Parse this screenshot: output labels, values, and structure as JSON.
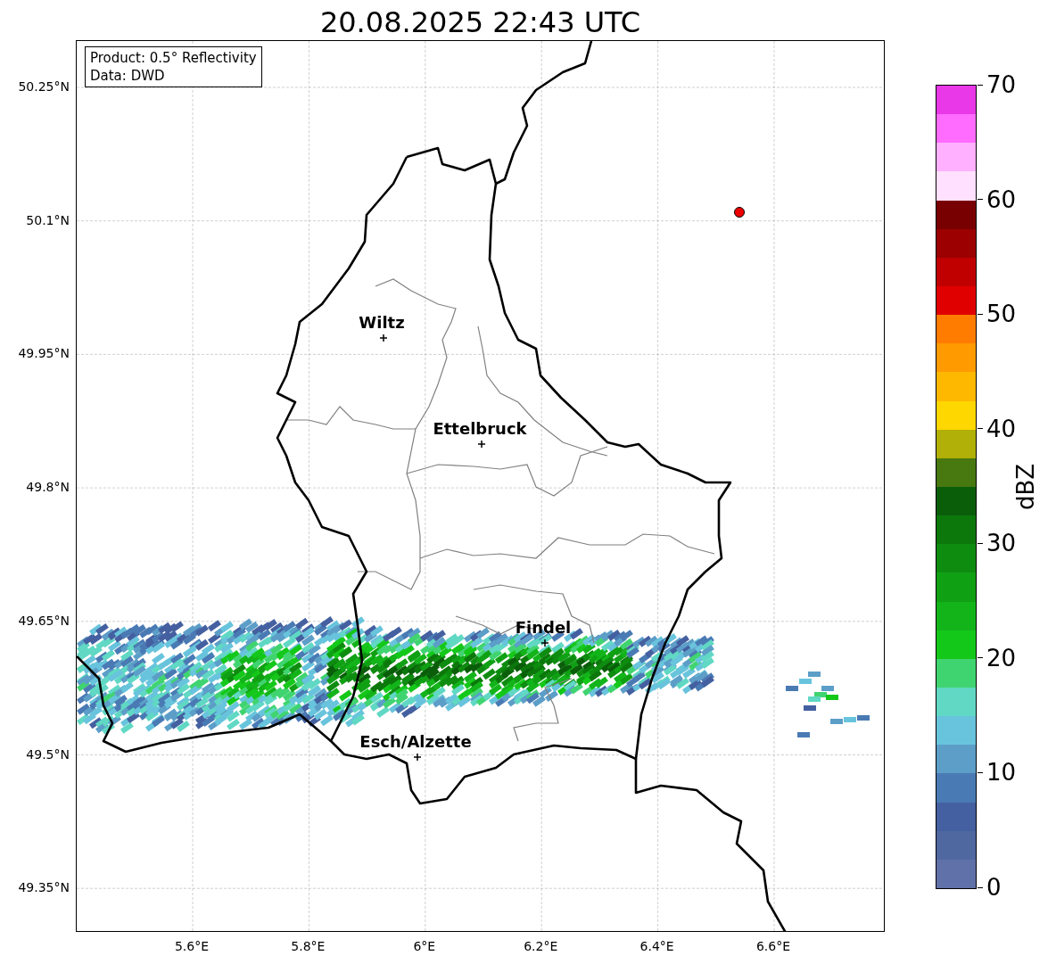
{
  "title": "20.08.2025 22:43 UTC",
  "info_box": {
    "lines": [
      "Product: 0.5° Reflectivity",
      "Data: DWD"
    ]
  },
  "map": {
    "lat_labels": [
      "50.25°N",
      "50.1°N",
      "49.95°N",
      "49.8°N",
      "49.65°N",
      "49.5°N",
      "49.35°N"
    ],
    "lon_labels": [
      "5.6°E",
      "5.8°E",
      "6°E",
      "6.2°E",
      "6.4°E",
      "6.6°E"
    ],
    "places": [
      {
        "name": "Wiltz"
      },
      {
        "name": "Ettelbruck"
      },
      {
        "name": "Findel"
      },
      {
        "name": "Esch/Alzette"
      }
    ]
  },
  "colorbar": {
    "label": "dBZ",
    "ticks": [
      "70",
      "60",
      "50",
      "40",
      "30",
      "20",
      "10",
      "0"
    ],
    "segments": [
      {
        "color": "#6070a8"
      },
      {
        "color": "#5068a0"
      },
      {
        "color": "#4460a0"
      },
      {
        "color": "#4a7ab4"
      },
      {
        "color": "#5c9ec8"
      },
      {
        "color": "#68c4dc"
      },
      {
        "color": "#60d8c4"
      },
      {
        "color": "#40d470"
      },
      {
        "color": "#14c81a"
      },
      {
        "color": "#12b41a"
      },
      {
        "color": "#10a014"
      },
      {
        "color": "#0e8c10"
      },
      {
        "color": "#0c780c"
      },
      {
        "color": "#0a5e0a"
      },
      {
        "color": "#487810"
      },
      {
        "color": "#b0b008"
      },
      {
        "color": "#ffd700"
      },
      {
        "color": "#ffb800"
      },
      {
        "color": "#ff9a00"
      },
      {
        "color": "#ff7c00"
      },
      {
        "color": "#e00000"
      },
      {
        "color": "#c00000"
      },
      {
        "color": "#9c0000"
      },
      {
        "color": "#780000"
      },
      {
        "color": "#ffe0ff"
      },
      {
        "color": "#ffb0ff"
      },
      {
        "color": "#ff6cff"
      },
      {
        "color": "#e838e8"
      }
    ]
  }
}
